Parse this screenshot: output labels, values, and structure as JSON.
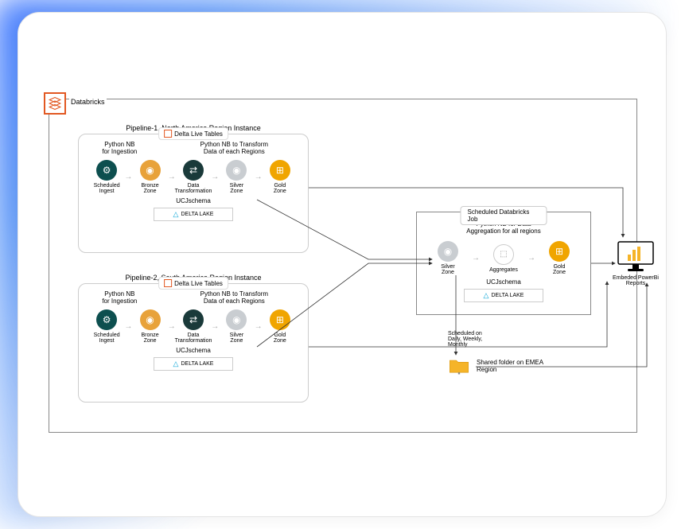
{
  "databricks": {
    "label": "Databricks"
  },
  "pipeline1": {
    "title": "Pipeline-1, North America Region Instance",
    "dlt": "Delta Live Tables",
    "sublabel1": "Python NB\nfor Ingestion",
    "sublabel2": "Python NB to Transform\nData of each Regions",
    "nodes": [
      "Scheduled\nIngest",
      "Bronze\nZone",
      "Data\nTransformation",
      "Silver\nZone",
      "Gold\nZone"
    ],
    "ucj": "UCJschema",
    "delta": "DELTA LAKE"
  },
  "pipeline2": {
    "title": "Pipeline-2, South America Region Instance",
    "dlt": "Delta Live Tables",
    "sublabel1": "Python NB\nfor Ingestion",
    "sublabel2": "Python NB to Transform\nData of each Regions",
    "nodes": [
      "Scheduled\nIngest",
      "Bronze\nZone",
      "Data\nTransformation",
      "Silver\nZone",
      "Gold\nZone"
    ],
    "ucj": "UCJschema",
    "delta": "DELTA LAKE"
  },
  "job": {
    "title": "Scheduled Databricks Job",
    "sublabel": "Python NB for Data\nAggregation for all regions",
    "nodes": [
      "Silver\nZone",
      "Aggregates",
      "Gold\nZone"
    ],
    "ucj": "UCJschema",
    "delta": "DELTA LAKE"
  },
  "schedule_text": "Scheduled on Daily, Weekly, Monthly",
  "folder_label": "Shared folder on EMEA Region",
  "monitor_label": "Embeded PowerBi Reports"
}
